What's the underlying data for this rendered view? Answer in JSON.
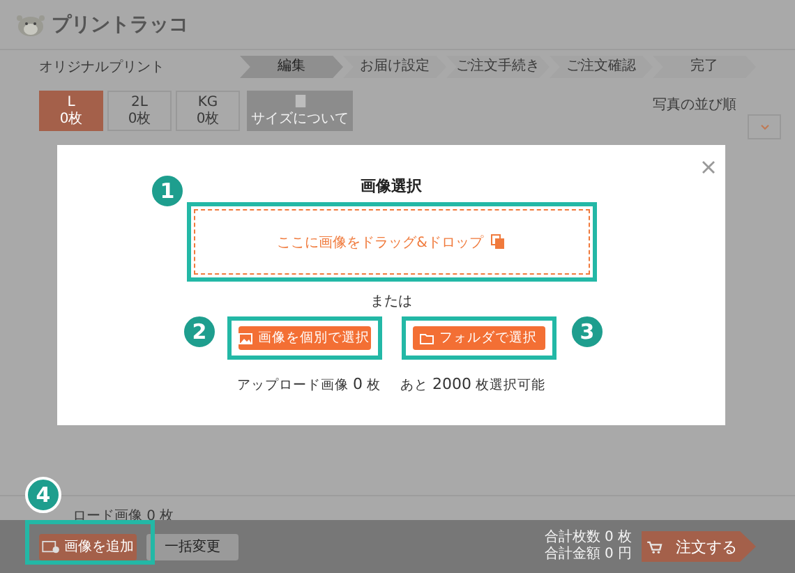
{
  "header": {
    "logo_text": "プリントラッコ"
  },
  "page_title": "オリジナルプリント",
  "steps": [
    {
      "label": "編集",
      "selected": true
    },
    {
      "label": "お届け設定",
      "selected": false
    },
    {
      "label": "ご注文手続き",
      "selected": false
    },
    {
      "label": "ご注文確認",
      "selected": false
    },
    {
      "label": "完了",
      "selected": false
    }
  ],
  "sizes": [
    {
      "kind": "size",
      "name": "L",
      "count": "0枚",
      "selected": true
    },
    {
      "kind": "size",
      "name": "2L",
      "count": "0枚",
      "selected": false
    },
    {
      "kind": "size",
      "name": "KG",
      "count": "0枚",
      "selected": false
    },
    {
      "kind": "info",
      "name": "サイズについて",
      "selected": false
    }
  ],
  "sort": {
    "label": "写真の並び順"
  },
  "modal": {
    "title": "画像選択",
    "dropzone_text": "ここに画像をドラッグ&ドロップ",
    "or_text": "または",
    "buttons": [
      {
        "kind": "image",
        "label": "画像を個別で選択"
      },
      {
        "kind": "folder",
        "label": "フォルダで選択"
      }
    ],
    "upload_label": "アップロード画像",
    "upload_count": "0",
    "upload_unit": "枚",
    "remaining_prefix": "あと",
    "remaining_count": "2000",
    "remaining_suffix": "枚選択可能"
  },
  "uploaded_summary": {
    "label": "ロード画像",
    "count": "0 枚"
  },
  "footer": {
    "add_button": "画像を追加",
    "bulk_button": "一括変更",
    "total_count_label": "合計枚数",
    "total_count": "0 枚",
    "total_price_label": "合計金額",
    "total_price": "0 円",
    "order_button": "注文する"
  },
  "annotations": [
    "1",
    "2",
    "3",
    "4"
  ]
}
